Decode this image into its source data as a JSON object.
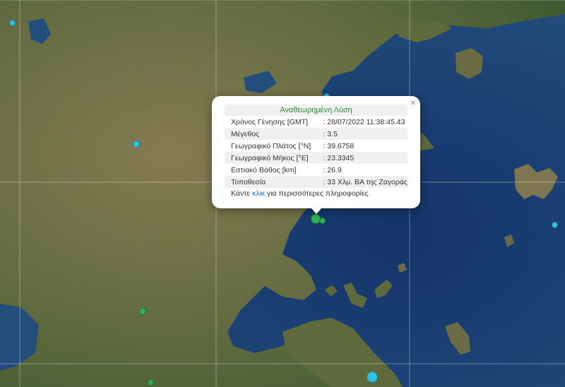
{
  "popup": {
    "title": "Αναθεωρημένη Λύση",
    "rows": [
      {
        "label": "Χρόνος Γένησης [GMT]",
        "value": ": 28/07/2022 11:38:45.43"
      },
      {
        "label": "Μέγεθος",
        "value": ": 3.5"
      },
      {
        "label": "Γεωγραφικό Πλάτος [°N]",
        "value": ": 39.6758"
      },
      {
        "label": "Γεωγραφικό Μήκος [°E]",
        "value": ": 23.3345"
      },
      {
        "label": "Εστιακό Βάθος [km]",
        "value": ": 26.9"
      },
      {
        "label": "Τοποθεσία",
        "value": ": 33 Χλμ. ΒΑ της Ζαγοράς"
      }
    ],
    "more_prefix": "Κάντε ",
    "more_link": "κλικ",
    "more_suffix": " για περισσότερες πληροφορίες",
    "close_label": "×"
  },
  "colors": {
    "sea": "#1b3d6e",
    "land": "#6e6a46",
    "marker_cyan": "#2fc3e3",
    "marker_green": "#2fb356",
    "popup_title": "#2e8b3a",
    "link": "#1e6fd0"
  },
  "icons": [
    "close-icon",
    "earthquake-marker"
  ]
}
